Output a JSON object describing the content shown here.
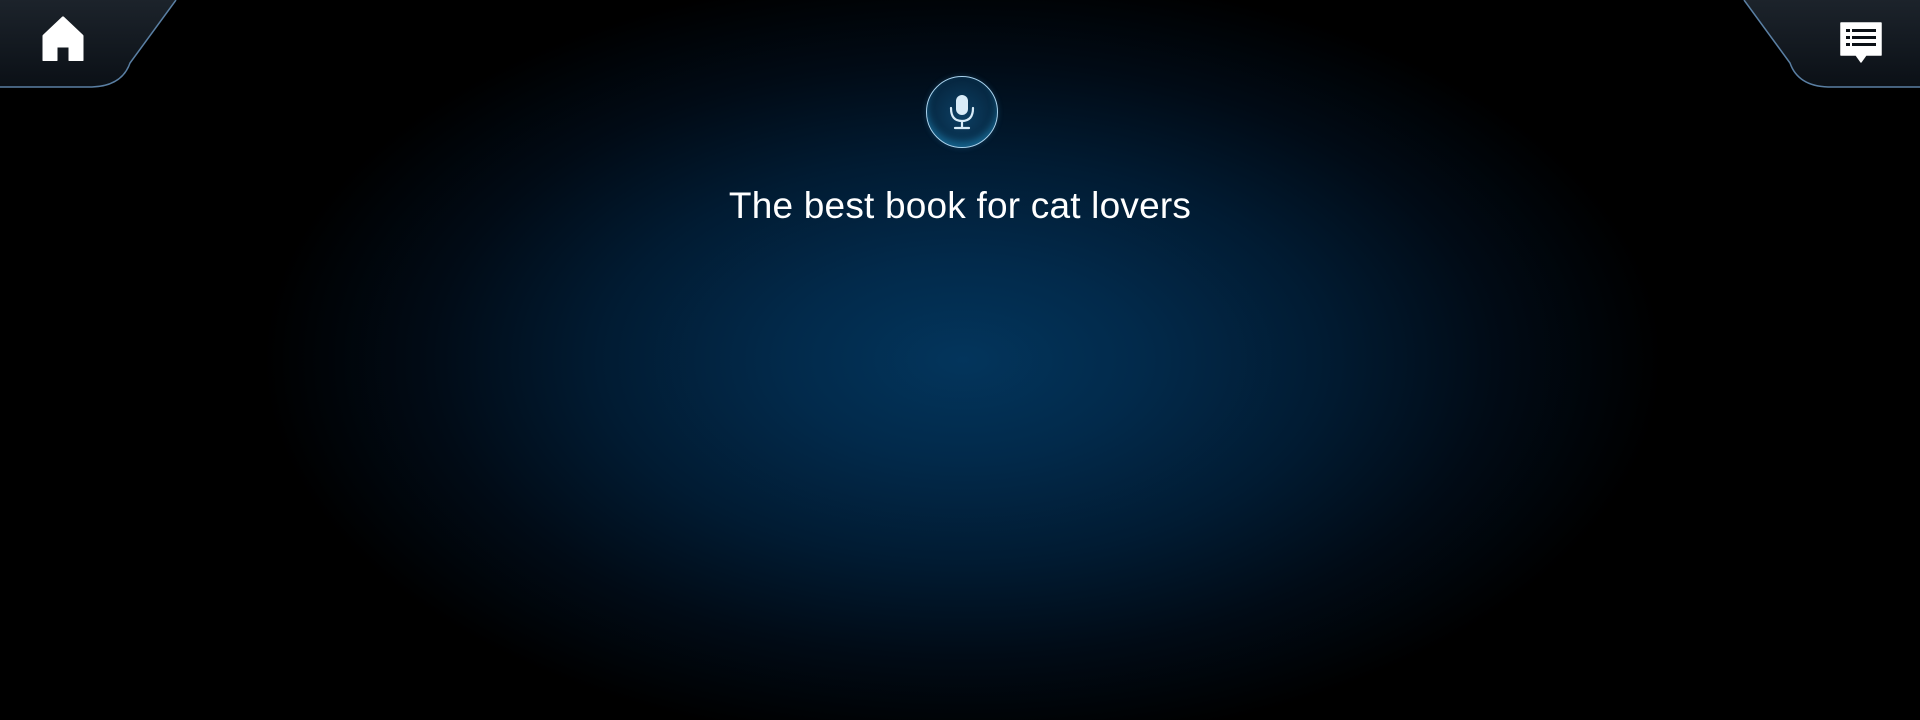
{
  "header": {
    "home_icon": "home-icon",
    "messages_icon": "message-list-icon"
  },
  "voice": {
    "mic_icon": "microphone-icon",
    "query": "The best book for cat lovers"
  },
  "colors": {
    "background_center": "#03355c",
    "background_edge": "#000000",
    "accent": "#a9d3ee",
    "text": "#ffffff"
  }
}
